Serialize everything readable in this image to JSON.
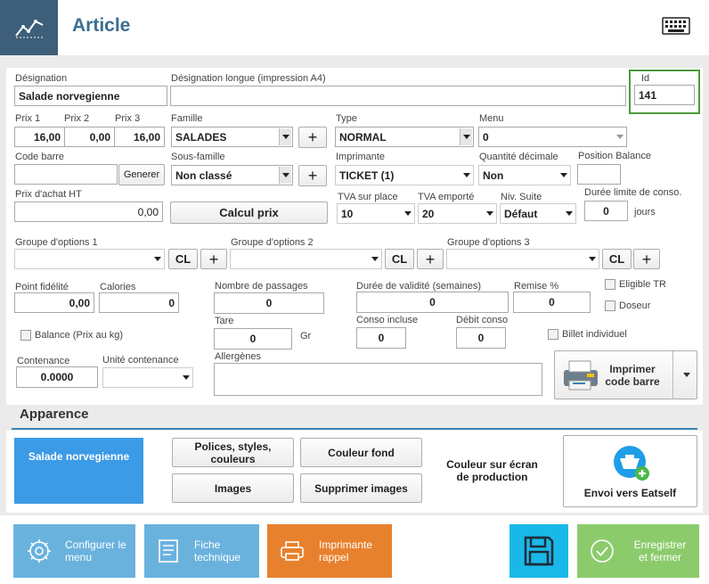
{
  "header": {
    "title": "Article"
  },
  "fields": {
    "designation": {
      "label": "Désignation",
      "value": "Salade norvegienne"
    },
    "designation_longue": {
      "label": "Désignation longue (impression A4)",
      "value": ""
    },
    "id": {
      "label": "Id",
      "value": "141"
    },
    "prix1": {
      "label": "Prix 1",
      "value": "16,00"
    },
    "prix2": {
      "label": "Prix 2",
      "value": "0,00"
    },
    "prix3": {
      "label": "Prix 3",
      "value": "16,00"
    },
    "famille": {
      "label": "Famille",
      "value": "SALADES"
    },
    "type": {
      "label": "Type",
      "value": "NORMAL"
    },
    "menu": {
      "label": "Menu",
      "value": "0"
    },
    "code_barre": {
      "label": "Code barre",
      "value": "",
      "button": "Generer"
    },
    "sous_famille": {
      "label": "Sous-famille",
      "value": "Non classé"
    },
    "imprimante": {
      "label": "Imprimante",
      "value": "TICKET  (1)"
    },
    "quantite_decimale": {
      "label": "Quantité décimale",
      "value": "Non"
    },
    "position_balance": {
      "label": "Position Balance",
      "value": ""
    },
    "prix_achat": {
      "label": "Prix d'achat HT",
      "value": "0,00"
    },
    "calcul_prix": "Calcul prix",
    "tva_place": {
      "label": "TVA sur place",
      "value": "10"
    },
    "tva_emporte": {
      "label": "TVA emporté",
      "value": "20"
    },
    "niv_suite": {
      "label": "Niv. Suite",
      "value": "Défaut"
    },
    "duree_limite": {
      "label": "Durée limite de conso.",
      "value": "0",
      "unit": "jours"
    },
    "groupe1": {
      "label": "Groupe d'options 1",
      "value": ""
    },
    "groupe2": {
      "label": "Groupe d'options 2",
      "value": ""
    },
    "groupe3": {
      "label": "Groupe d'options 3",
      "value": ""
    },
    "cl_label": "CL",
    "point_fidelite": {
      "label": "Point fidélité",
      "value": "0,00"
    },
    "calories": {
      "label": "Calories",
      "value": "0"
    },
    "nombre_passages": {
      "label": "Nombre de passages",
      "value": "0"
    },
    "duree_validite": {
      "label": "Durée de validité (semaines)",
      "value": "0"
    },
    "remise": {
      "label": "Remise %",
      "value": "0"
    },
    "eligible_tr": "Eligible TR",
    "doseur": "Doseur",
    "balance": "Balance (Prix au kg)",
    "tare": {
      "label": "Tare",
      "value": "0",
      "unit": "Gr"
    },
    "conso_incluse": {
      "label": "Conso incluse",
      "value": "0"
    },
    "debit_conso": {
      "label": "Débit conso",
      "value": "0"
    },
    "billet_individuel": "Billet individuel",
    "contenance": {
      "label": "Contenance",
      "value": "0.0000"
    },
    "unite_contenance": {
      "label": "Unité contenance",
      "value": ""
    },
    "allergenes": {
      "label": "Allergènes",
      "value": ""
    },
    "imprimer_code_barre": "Imprimer code barre"
  },
  "apparence": {
    "title": "Apparence",
    "preview": "Salade norvegienne",
    "polices": "Polices, styles, couleurs",
    "couleur_fond": "Couleur fond",
    "images": "Images",
    "supprimer_images": "Supprimer images",
    "couleur_ecran": "Couleur sur écran de production",
    "envoi_eatself": "Envoi vers Eatself"
  },
  "footer": {
    "configurer": "Configurer le menu",
    "fiche": "Fiche technique",
    "imprimante_rappel": "Imprimante rappel",
    "enregistrer": "Enregistrer et fermer"
  },
  "colors": {
    "header": "#3d5f7a",
    "title": "#3b6e92",
    "tile_blue": "#6ab2de",
    "tile_orange": "#e8812d",
    "tile_cyan": "#19b8e8",
    "tile_green": "#8ccb6c",
    "preview": "#3c9be6"
  }
}
